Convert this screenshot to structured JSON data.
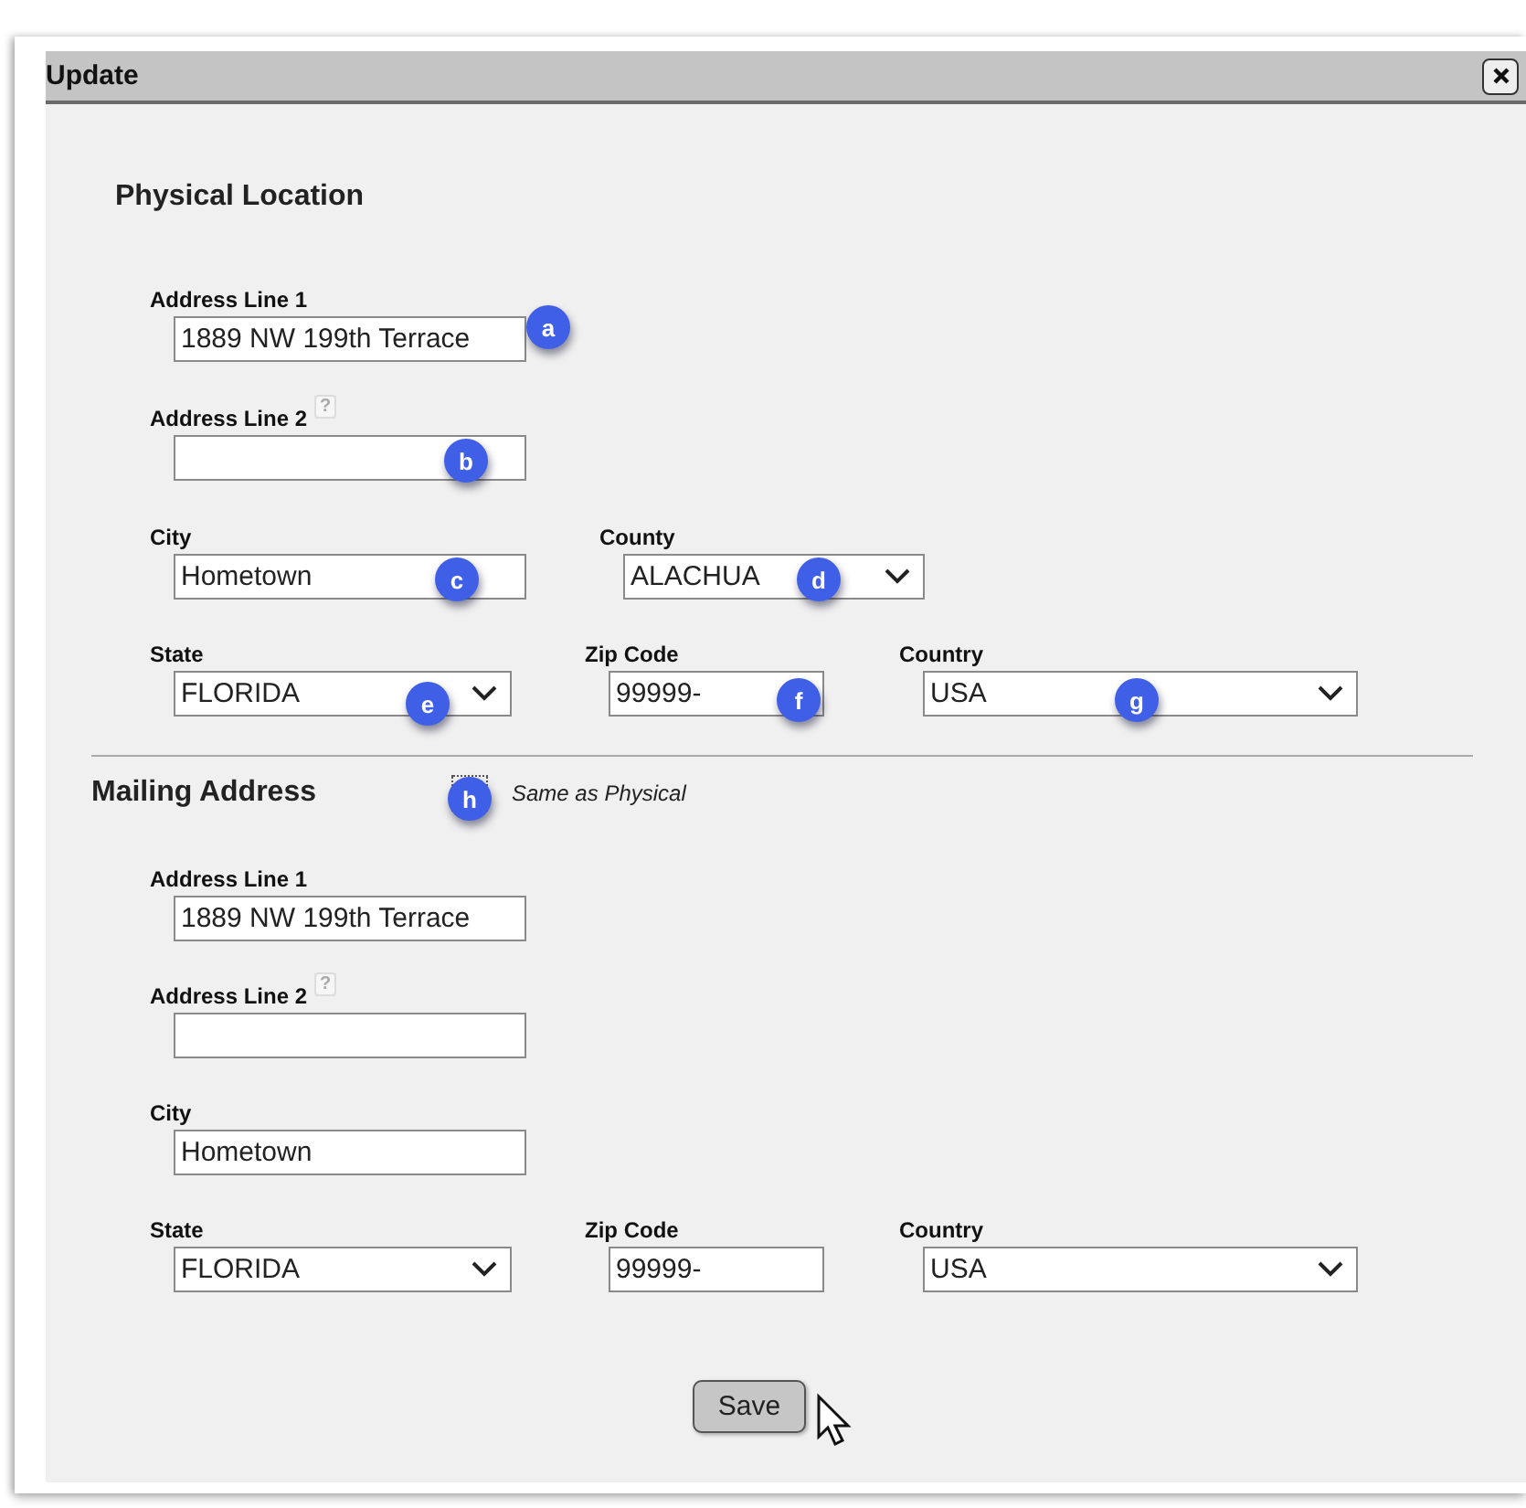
{
  "dialog": {
    "title": "Update",
    "sections": [
      {
        "heading": "Physical Location",
        "rows": [
          [
            {
              "label": "Address Line 1",
              "kind": "text",
              "value": "1889 NW 199th Terrace",
              "marker": "a"
            }
          ],
          [
            {
              "label": "Address Line 2",
              "kind": "text",
              "help": "?",
              "marker": "b"
            }
          ],
          [
            {
              "label": "City",
              "kind": "text",
              "value": "Hometown",
              "marker": "c"
            },
            {
              "label": "County",
              "kind": "select",
              "value": "ALACHUA",
              "marker": "d"
            }
          ],
          [
            {
              "label": "State",
              "kind": "select",
              "value": "FLORIDA",
              "marker": "e"
            },
            {
              "label": "Zip Code",
              "kind": "text",
              "value": "99999-",
              "marker": "f"
            },
            {
              "label": "Country",
              "kind": "select",
              "value": "USA",
              "marker": "g"
            }
          ]
        ]
      },
      {
        "heading": "Mailing Address",
        "same_as": {
          "label": "Same as Physical",
          "marker": "h"
        },
        "rows": [
          [
            {
              "label": "Address Line 1",
              "kind": "text",
              "value": "1889 NW 199th Terrace"
            }
          ],
          [
            {
              "label": "Address Line 2",
              "kind": "text",
              "help": "?"
            }
          ],
          [
            {
              "label": "City",
              "kind": "text",
              "value": "Hometown"
            }
          ],
          [
            {
              "label": "State",
              "kind": "select",
              "value": "FLORIDA"
            },
            {
              "label": "Zip Code",
              "kind": "text",
              "value": "99999-"
            },
            {
              "label": "Country",
              "kind": "select",
              "value": "USA"
            }
          ]
        ]
      }
    ],
    "save_button": "Save"
  }
}
